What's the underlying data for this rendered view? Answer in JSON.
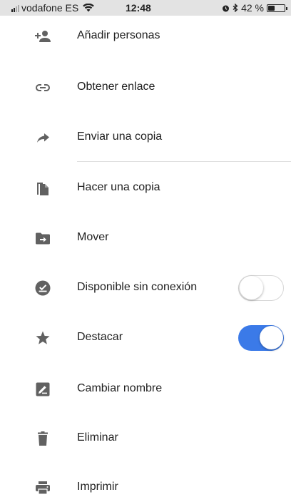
{
  "status_bar": {
    "carrier": "vodafone ES",
    "time": "12:48",
    "battery_percent": "42 %",
    "battery_level": 0.42
  },
  "menu": {
    "items": [
      {
        "label": "Añadir personas",
        "icon": "add-person-icon"
      },
      {
        "label": "Obtener enlace",
        "icon": "link-icon"
      },
      {
        "label": "Enviar una copia",
        "icon": "share-arrow-icon"
      },
      {
        "label": "Hacer una copia",
        "icon": "copy-file-icon"
      },
      {
        "label": "Mover",
        "icon": "move-folder-icon"
      },
      {
        "label": "Disponible sin conexión",
        "icon": "offline-check-icon",
        "toggle": false
      },
      {
        "label": "Destacar",
        "icon": "star-icon",
        "toggle": true
      },
      {
        "label": "Cambiar nombre",
        "icon": "rename-icon"
      },
      {
        "label": "Eliminar",
        "icon": "trash-icon"
      },
      {
        "label": "Imprimir",
        "icon": "print-icon"
      }
    ]
  },
  "colors": {
    "icon": "#616161",
    "toggle_on": "#3b7ae8",
    "status_bar_bg": "#e3e3e3"
  }
}
